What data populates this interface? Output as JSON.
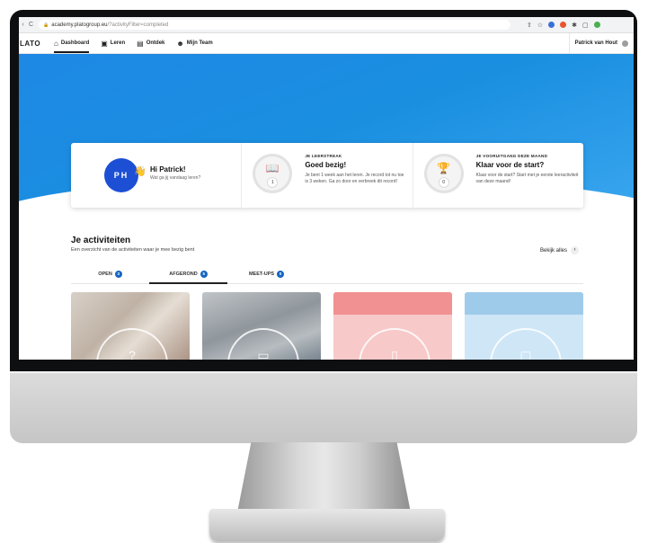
{
  "browser": {
    "back": "‹",
    "reload": "C",
    "url_host": "academy.platogroup.eu",
    "url_path": "/?activityFilter=completed"
  },
  "nav": {
    "logo": "LATO",
    "items": [
      {
        "label": "Dashboard",
        "icon": "home-icon"
      },
      {
        "label": "Leren",
        "icon": "learn-icon"
      },
      {
        "label": "Ontdek",
        "icon": "discover-icon"
      },
      {
        "label": "Mijn Team",
        "icon": "team-icon"
      }
    ],
    "user": "Patrick van Hout"
  },
  "greeting": {
    "initials": "PH",
    "wave": "👋",
    "title": "Hi Patrick!",
    "subtitle": "Wat ga jij vandaag leren?"
  },
  "streak": {
    "eyebrow": "JE LEERSTREAK",
    "title": "Goed bezig!",
    "text": "Je bent 1 week aan het leren. Je record tot nu toe is 3 weken. Ga zo door en verbreek dit record!",
    "count": "1"
  },
  "progress": {
    "eyebrow": "JE VOORUITGANG DEZE MAAND",
    "title": "Klaar voor de start?",
    "text": "Klaar voor de start? Start met je eerste leeractiviteit van deze maand!",
    "count": "0"
  },
  "activities": {
    "title": "Je activiteiten",
    "subtitle": "Een overzicht van de activiteiten waar je mee bezig bent",
    "view_all": "Bekijk alles",
    "tabs": [
      {
        "label": "OPEN",
        "count": "3"
      },
      {
        "label": "AFGEROND",
        "count": "5"
      },
      {
        "label": "MEET-UPS",
        "count": "0"
      }
    ]
  },
  "colors": {
    "hero_blue": "#1e88e5",
    "avatar_blue": "#1c4fd4",
    "badge_blue": "#1565c0"
  }
}
